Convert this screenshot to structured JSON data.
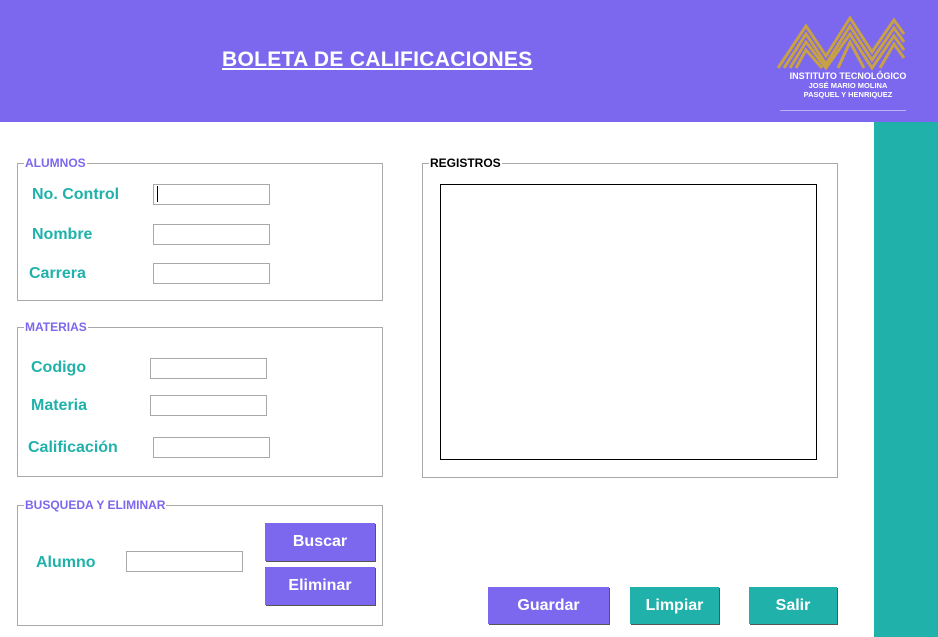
{
  "header": {
    "title": "BOLETA DE CALIFICACIONES",
    "logo": {
      "line1": "INSTITUTO TECNOLÓGICO",
      "line2": "JOSÉ MARIO MOLINA",
      "line3": "PASQUEL Y HENRIQUEZ"
    }
  },
  "alumnos": {
    "title": "ALUMNOS",
    "no_control_label": "No. Control",
    "nombre_label": "Nombre",
    "carrera_label": "Carrera",
    "no_control_value": "",
    "nombre_value": "",
    "carrera_value": ""
  },
  "materias": {
    "title": "MATERIAS",
    "codigo_label": "Codigo",
    "materia_label": "Materia",
    "calificacion_label": "Calificación",
    "codigo_value": "",
    "materia_value": "",
    "calificacion_value": ""
  },
  "busqueda": {
    "title": "BUSQUEDA Y ELIMINAR",
    "alumno_label": "Alumno",
    "alumno_value": "",
    "buscar_label": "Buscar",
    "eliminar_label": "Eliminar"
  },
  "registros": {
    "title": "REGISTROS"
  },
  "actions": {
    "guardar_label": "Guardar",
    "limpiar_label": "Limpiar",
    "salir_label": "Salir"
  },
  "colors": {
    "purple": "#7b68ee",
    "teal": "#20b2aa",
    "gold": "#c8a046"
  },
  "icons": {
    "logo": "institute-logo-icon"
  }
}
